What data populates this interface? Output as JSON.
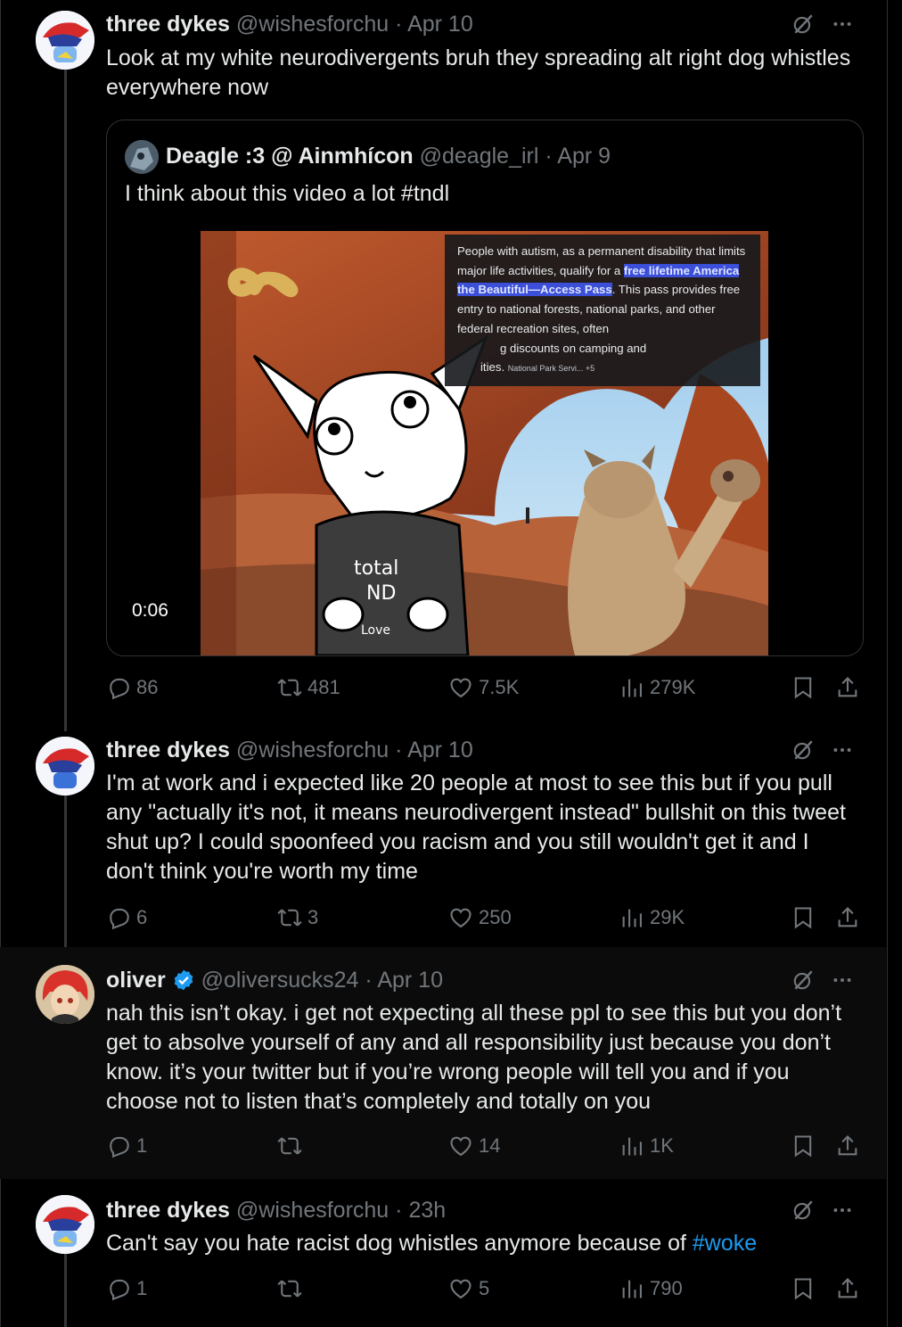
{
  "tweets": [
    {
      "display_name": "three dykes",
      "handle": "@wishesforchu",
      "sep": "·",
      "time": "Apr 10",
      "text": "Look at my white neurodivergents bruh they spreading alt right dog whistles everywhere now",
      "quote": {
        "display_name": "Deagle :3 @ Ainmhícon",
        "handle": "@deagle_irl",
        "sep": "·",
        "time": "Apr 9",
        "text": "I think about this video a lot #tndl",
        "video": {
          "duration": "0:06",
          "overlay_text_1": "People with autism, as a permanent disability that limits major life activities, qualify for a ",
          "overlay_highlight": "free lifetime America the Beautiful—Access Pass",
          "overlay_text_2": ". This pass provides free entry to national forests, national parks, and other federal recreation sites, often",
          "overlay_text_3": "g discounts on camping and",
          "overlay_text_4": "ities.",
          "overlay_source": "National Park Servi... +5",
          "shirt_line1": "total",
          "shirt_line2": "ND",
          "shirt_line3": "Love"
        }
      },
      "stats": {
        "replies": "86",
        "reposts": "481",
        "likes": "7.5K",
        "views": "279K"
      }
    },
    {
      "display_name": "three dykes",
      "handle": "@wishesforchu",
      "sep": "·",
      "time": "Apr 10",
      "text": "I'm at work and i expected like 20 people at most to see this but if you pull any \"actually it's not, it means neurodivergent instead\" bullshit on this tweet shut up? I could spoonfeed you racism and you still wouldn't get it and I don't think you're worth my time",
      "stats": {
        "replies": "6",
        "reposts": "3",
        "likes": "250",
        "views": "29K"
      }
    },
    {
      "display_name": "oliver",
      "verified": true,
      "handle": "@oliversucks24",
      "sep": "·",
      "time": "Apr 10",
      "text": "nah this isn’t okay. i get not expecting all these ppl to see this but you don’t get to absolve yourself of any and all responsibility just because you don’t know. it’s your twitter but if you’re wrong people will tell you and if you choose not to listen that’s completely and totally on you",
      "stats": {
        "replies": "1",
        "reposts": "",
        "likes": "14",
        "views": "1K"
      }
    },
    {
      "display_name": "three dykes",
      "handle": "@wishesforchu",
      "sep": "·",
      "time": "23h",
      "text_before": "Can't say you hate racist dog whistles anymore because of ",
      "hashtag": "#woke",
      "stats": {
        "replies": "1",
        "reposts": "",
        "likes": "5",
        "views": "790"
      }
    }
  ],
  "icons": {
    "reply": "reply-icon",
    "repost": "repost-icon",
    "like": "heart-icon",
    "views": "views-icon",
    "bookmark": "bookmark-icon",
    "share": "share-icon",
    "grok": "grok-icon",
    "more": "more-icon",
    "verified": "verified-badge-icon"
  },
  "colors": {
    "background": "#000000",
    "text": "#e7e9ea",
    "muted": "#71767b",
    "accent": "#1d9bf0"
  }
}
